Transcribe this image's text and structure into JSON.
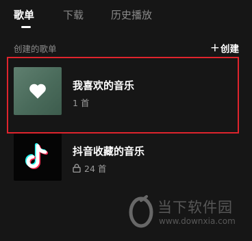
{
  "tabs": [
    {
      "label": "歌单",
      "active": true
    },
    {
      "label": "下载",
      "active": false
    },
    {
      "label": "历史播放",
      "active": false
    }
  ],
  "section": {
    "title": "创建的歌单",
    "create_label": "创建",
    "create_icon": "plus-icon"
  },
  "playlists": [
    {
      "name": "我喜欢的音乐",
      "count": "1 首",
      "cover_icon": "heart-icon",
      "cover_color": "#5a7a6a",
      "locked": false
    },
    {
      "name": "抖音收藏的音乐",
      "count": "24 首",
      "cover_icon": "tiktok-logo-icon",
      "cover_color": "#050505",
      "locked": true
    }
  ],
  "highlight_color": "#e0242d",
  "watermark": {
    "name": "当下软件园",
    "url": "www.downxia.com"
  }
}
